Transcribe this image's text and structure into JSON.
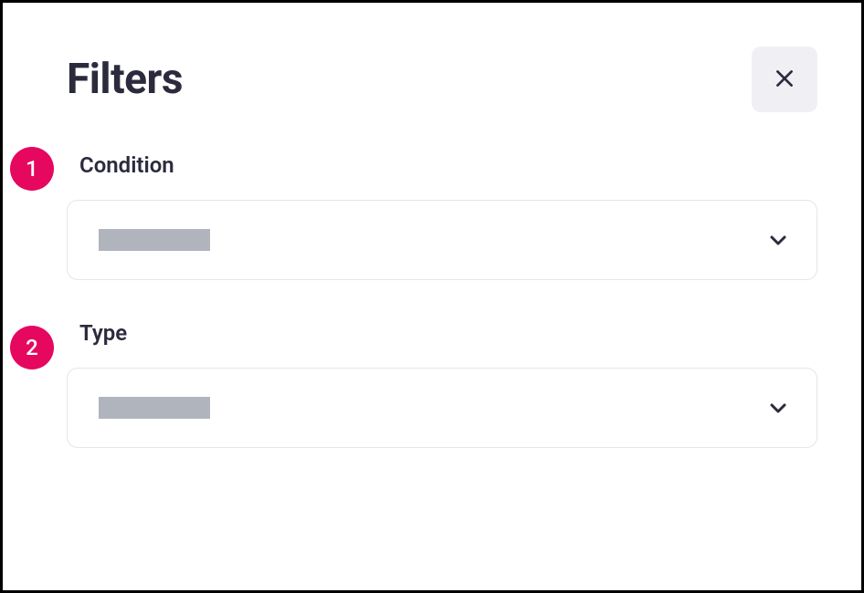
{
  "header": {
    "title": "Filters"
  },
  "filters": [
    {
      "label": "Condition",
      "badge": "1"
    },
    {
      "label": "Type",
      "badge": "2"
    }
  ]
}
